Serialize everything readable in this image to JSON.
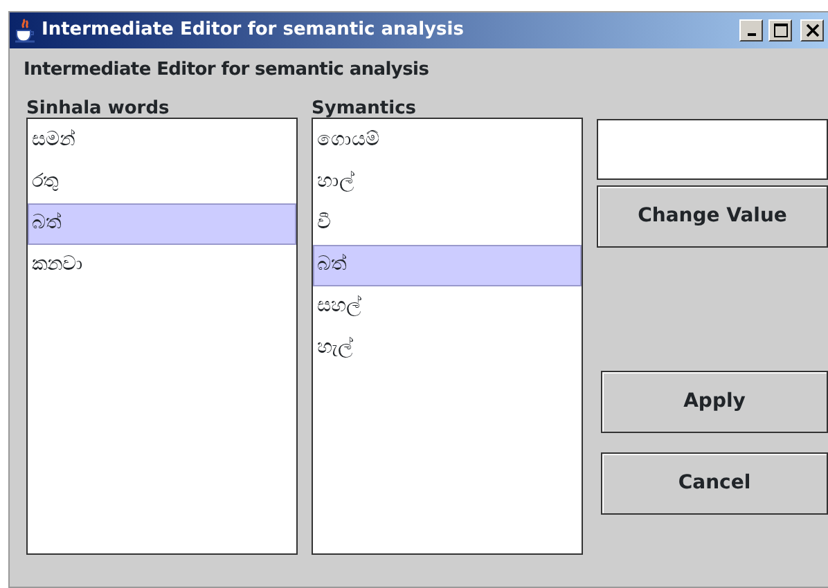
{
  "window": {
    "title": "Intermediate Editor for semantic analysis"
  },
  "heading": "Intermediate Editor for semantic analysis",
  "sinhala_words": {
    "label": "Sinhala words",
    "items": [
      {
        "text": "සමන්",
        "selected": false
      },
      {
        "text": "රතු",
        "selected": false
      },
      {
        "text": "බත්",
        "selected": true
      },
      {
        "text": "කනවා",
        "selected": false
      }
    ]
  },
  "symantics": {
    "label": "Symantics",
    "items": [
      {
        "text": "ගොයම්",
        "selected": false
      },
      {
        "text": "හාල්",
        "selected": false
      },
      {
        "text": "වී",
        "selected": false
      },
      {
        "text": "බත්",
        "selected": true
      },
      {
        "text": "සහල්",
        "selected": false
      },
      {
        "text": "හැල්",
        "selected": false
      }
    ]
  },
  "buttons": {
    "change": "Change Value",
    "apply": "Apply",
    "cancel": "Cancel"
  }
}
